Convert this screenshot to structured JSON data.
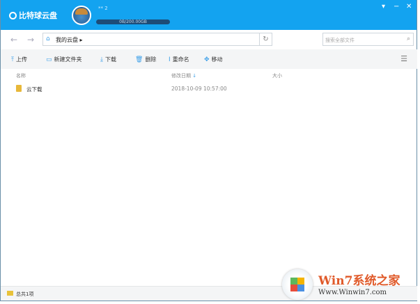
{
  "app": {
    "title": "比特球云盘",
    "username": "** 2",
    "quota": "0B/200.00GB"
  },
  "window": {
    "menu": "▾",
    "minimize": "−",
    "close": "✕"
  },
  "nav": {
    "back": "←",
    "forward": "→",
    "path": "我的云盘",
    "path_sep": "▸",
    "search_placeholder": "搜索全部文件"
  },
  "toolbar": {
    "upload": "上传",
    "new_folder": "新建文件夹",
    "download": "下载",
    "delete": "删除",
    "rename": "重命名",
    "move": "移动"
  },
  "columns": {
    "name": "名称",
    "modified": "修改日期",
    "size": "大小",
    "sort_arrow": "↓"
  },
  "files": [
    {
      "name": "云下载",
      "modified": "2018-10-09 10:57:00",
      "size": ""
    }
  ],
  "status": {
    "count": "总共1项"
  },
  "watermark": {
    "title": "Win7系统之家",
    "url": "Www.Winwin7.com"
  },
  "colors": {
    "header": "#13a3f0",
    "accent": "#3a9ee8"
  }
}
